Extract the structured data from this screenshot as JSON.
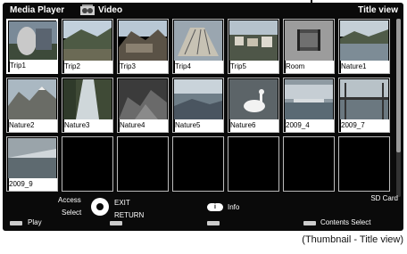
{
  "header": {
    "title": "Media Player",
    "section": "Video",
    "view": "Title view",
    "video_icon": "film-reel-icon"
  },
  "thumbnails": [
    {
      "label": "Trip1",
      "scene": "statue"
    },
    {
      "label": "Trip2",
      "scene": "landscape"
    },
    {
      "label": "Trip3",
      "scene": "ruins"
    },
    {
      "label": "Trip4",
      "scene": "building"
    },
    {
      "label": "Trip5",
      "scene": "houses"
    },
    {
      "label": "Room",
      "scene": "film-placeholder"
    },
    {
      "label": "Nature1",
      "scene": "lake"
    },
    {
      "label": "Nature2",
      "scene": "mountain"
    },
    {
      "label": "Nature3",
      "scene": "forest-river"
    },
    {
      "label": "Nature4",
      "scene": "rocks"
    },
    {
      "label": "Nature5",
      "scene": "sea"
    },
    {
      "label": "Nature6",
      "scene": "swan"
    },
    {
      "label": "2009_4",
      "scene": "pool"
    },
    {
      "label": "2009_7",
      "scene": "bridge"
    },
    {
      "label": "2009_9",
      "scene": "waterfront"
    },
    {
      "label": "",
      "scene": "empty"
    },
    {
      "label": "",
      "scene": "empty"
    },
    {
      "label": "",
      "scene": "empty"
    },
    {
      "label": "",
      "scene": "empty"
    },
    {
      "label": "",
      "scene": "empty"
    },
    {
      "label": "",
      "scene": "empty"
    }
  ],
  "selected_index": 0,
  "footer": {
    "access": "Access",
    "select": "Select",
    "exit": "EXIT",
    "return": "RETURN",
    "info": "Info",
    "info_icon": "i",
    "sd": "SD Card",
    "play": "Play",
    "contents_select": "Contents Select"
  },
  "colors": {
    "screen_bg": "#0a0a0a",
    "tile_border": "#bbbbbb",
    "selected_border": "#ffffff",
    "button_grey": "#cccccc"
  },
  "caption": "(Thumbnail - Title view)"
}
